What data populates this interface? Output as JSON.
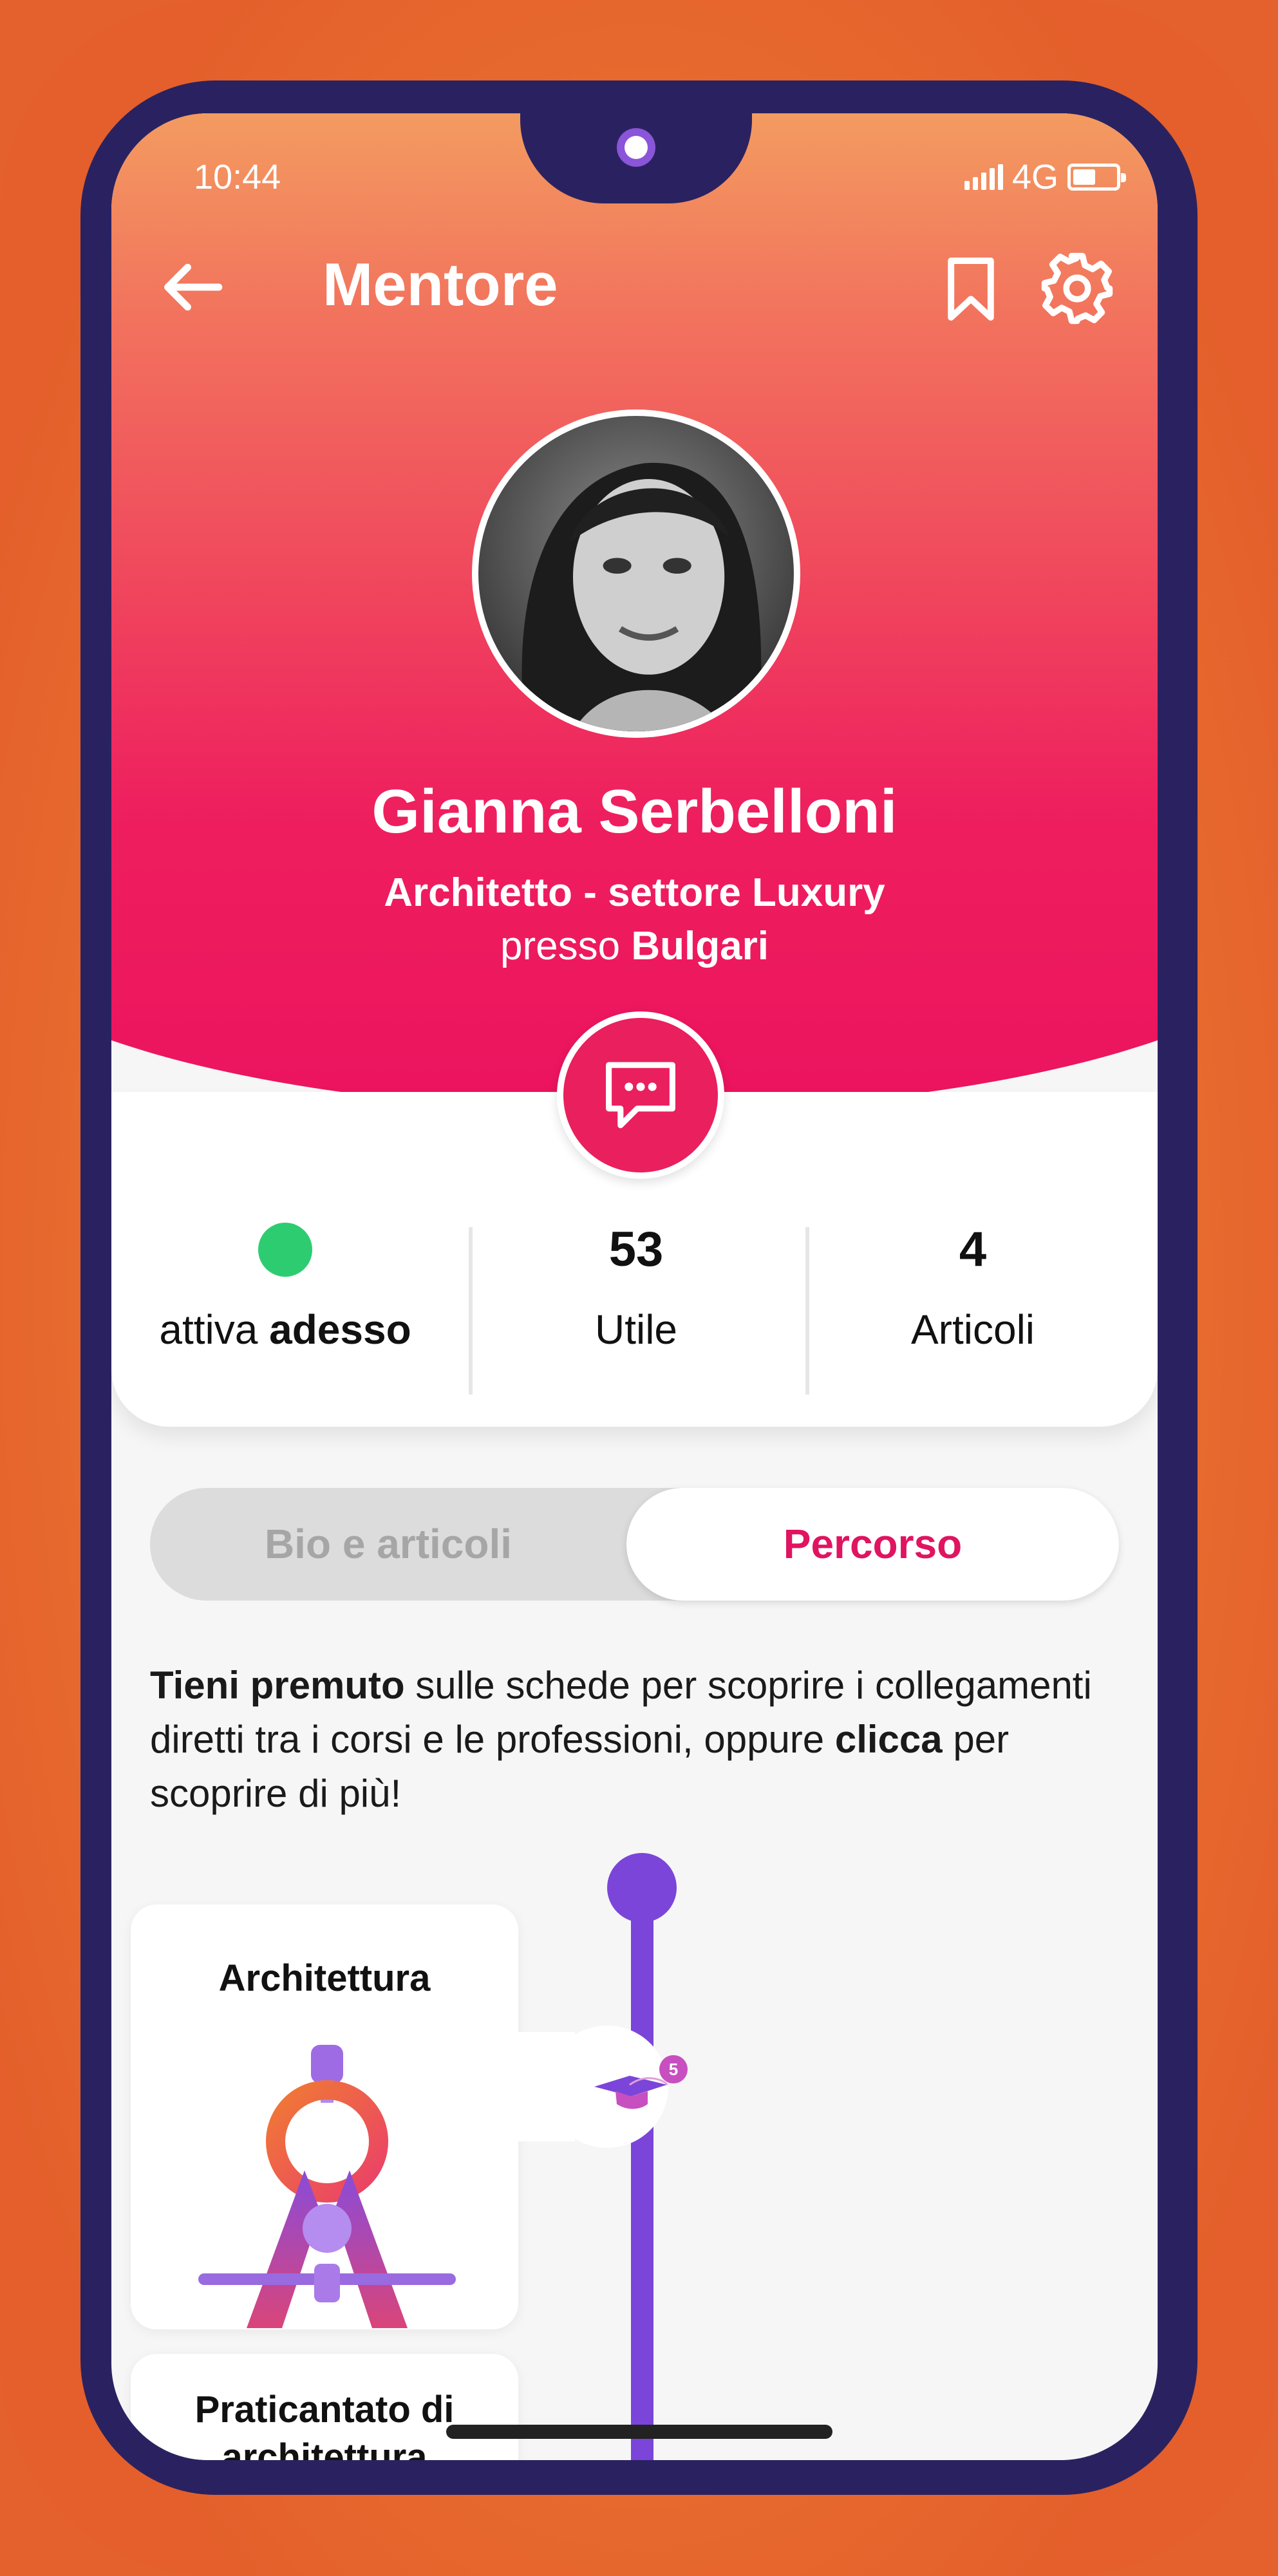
{
  "status_bar": {
    "time": "10:44",
    "network": "4G"
  },
  "header": {
    "title": "Mentore"
  },
  "profile": {
    "name": "Gianna Serbelloni",
    "role": "Architetto - settore Luxury",
    "company_prefix": "presso",
    "company": "Bulgari"
  },
  "stats": {
    "status_prefix": "attiva",
    "status_strong": "adesso",
    "useful_count": "53",
    "useful_label": "Utile",
    "articles_count": "4",
    "articles_label": "Articoli"
  },
  "tabs": {
    "bio": "Bio e articoli",
    "path": "Percorso",
    "active": "Percorso"
  },
  "hint": {
    "part1_strong": "Tieni premuto",
    "part2": " sulle schede per scoprire i collegamenti diretti tra i corsi e le professioni, oppure ",
    "part3_strong": "clicca",
    "part4": " per scoprire di più!"
  },
  "cards": [
    {
      "title": "Architettura",
      "badge": "5"
    },
    {
      "title": "Praticantato di architettura"
    }
  ],
  "colors": {
    "accent": "#ec135f",
    "timeline": "#7b45d9",
    "online": "#2ecc71",
    "phone_frame": "#2a2260"
  },
  "icons": [
    "back-arrow-icon",
    "bookmark-icon",
    "gear-icon",
    "chat-bubble-icon",
    "graduation-cap-icon",
    "compass-icon"
  ]
}
